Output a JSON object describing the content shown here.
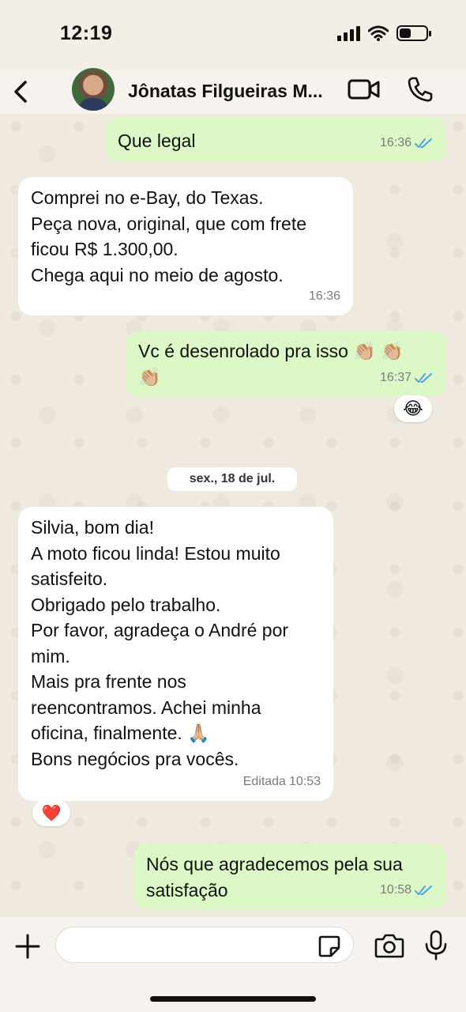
{
  "status": {
    "time": "12:19",
    "battery_level": 0.45
  },
  "header": {
    "contact_name": "Jônatas Filgueiras M..."
  },
  "messages": [
    {
      "id": "m1",
      "direction": "outgoing",
      "text": "Que legal",
      "time": "16:36",
      "read": true
    },
    {
      "id": "m2",
      "direction": "incoming",
      "text": "Comprei no e-Bay, do Texas.\nPeça nova, original, que com frete\nficou R$ 1.300,00.\nChega aqui no meio de agosto.",
      "time": "16:36"
    },
    {
      "id": "m3",
      "direction": "outgoing",
      "text": "Vc é desenrolado pra isso 👏🏼 👏🏼\n👏🏼",
      "time": "16:37",
      "read": true,
      "reaction": "😂"
    },
    {
      "id": "m4",
      "direction": "incoming",
      "text": "Silvia, bom dia!\nA moto ficou linda! Estou muito\nsatisfeito.\nObrigado pelo trabalho.\nPor favor, agradeça o André por\nmim.\nMais pra frente nos\nreencontramos. Achei minha\noficina, finalmente. 🙏🏼\nBons negócios pra vocês.",
      "time": "10:53",
      "edited_label": "Editada",
      "reaction": "❤️"
    },
    {
      "id": "m5",
      "direction": "outgoing",
      "text": "Nós que agradecemos pela sua\nsatisfação",
      "time": "10:58",
      "read": true
    }
  ],
  "date_separator": "sex., 18 de jul.",
  "composer": {
    "placeholder": ""
  },
  "colors": {
    "outgoing_bubble": "#dcf8c6",
    "incoming_bubble": "#ffffff",
    "read_ticks": "#4fa3e0"
  }
}
